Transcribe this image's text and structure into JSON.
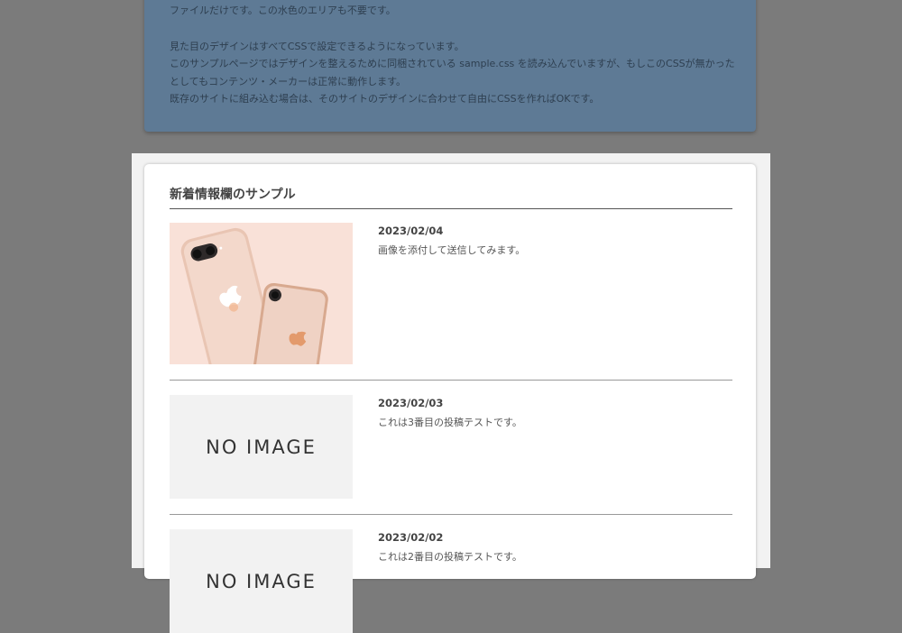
{
  "info": {
    "line1": "ファイルだけです。この水色のエリアも不要です。",
    "line2": "見た目のデザインはすべてCSSで設定できるようになっています。",
    "line3": "このサンプルページではデザインを整えるために同梱されている sample.css を読み込んでいますが、もしこのCSSが無かった",
    "line4": "としてもコンテンツ・メーカーは正常に動作します。",
    "line5": "既存のサイトに組み込む場合は、そのサイトのデザインに合わせて自由にCSSを作ればOKです。"
  },
  "news": {
    "title": "新着情報欄のサンプル",
    "no_image_label": "NO IMAGE",
    "items": [
      {
        "date": "2023/02/04",
        "text": "画像を添付して送信してみます。",
        "has_image": true
      },
      {
        "date": "2023/02/03",
        "text": "これは3番目の投稿テストです。",
        "has_image": false
      },
      {
        "date": "2023/02/02",
        "text": "これは2番目の投稿テストです。",
        "has_image": false
      }
    ]
  },
  "colors": {
    "overlay": "#7b7b7b",
    "info_box": "#5e7a95",
    "card": "#ffffff",
    "frame": "#f2f2f2",
    "phone_bg": "#f7ddd2"
  }
}
